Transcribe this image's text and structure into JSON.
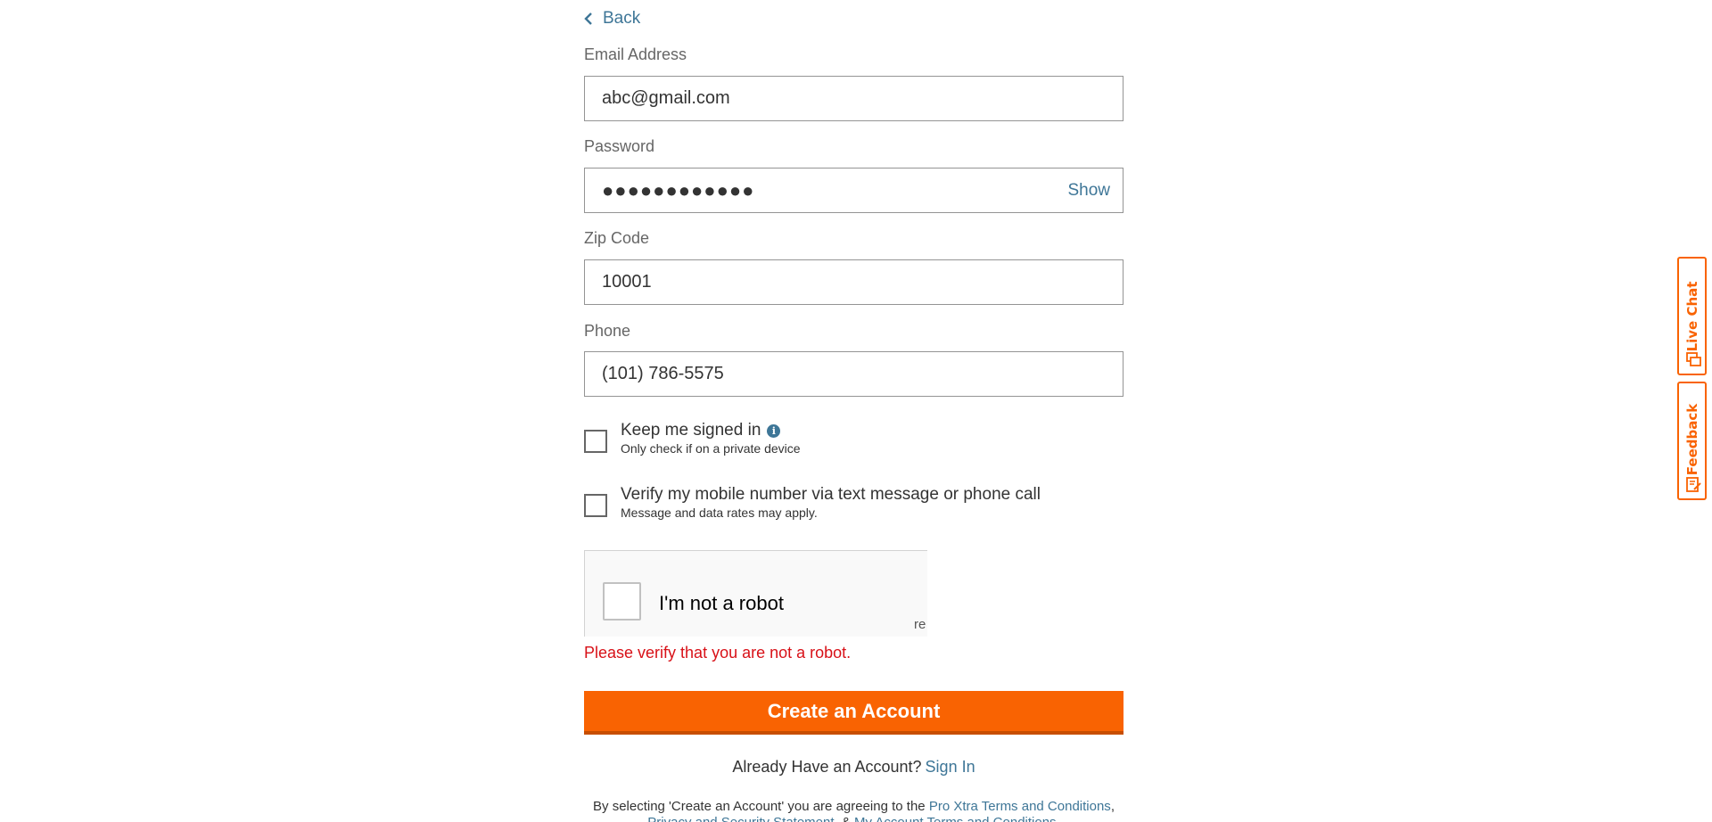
{
  "nav": {
    "back_label": "Back"
  },
  "form": {
    "email": {
      "label": "Email Address",
      "value": "abc@gmail.com"
    },
    "password": {
      "label": "Password",
      "masked_value": "●●●●●●●●●●●●",
      "show_label": "Show"
    },
    "zip": {
      "label": "Zip Code",
      "value": "10001"
    },
    "phone": {
      "label": "Phone",
      "value": "(101) 786-5575"
    },
    "keep_signed_in": {
      "label": "Keep me signed in",
      "sublabel": "Only check if on a private device",
      "checked": false,
      "info_icon": "info-icon"
    },
    "verify_mobile": {
      "label": "Verify my mobile number via text message or phone call",
      "sublabel": "Message and data rates may apply.",
      "checked": false
    }
  },
  "recaptcha": {
    "label": "I'm not a robot",
    "brand_fragment": "re"
  },
  "error_message": "Please verify that you are not a robot.",
  "submit_label": "Create an Account",
  "signin": {
    "prompt": "Already Have an Account?",
    "link": "Sign In"
  },
  "legal": {
    "prefix": "By selecting 'Create an Account' you are agreeing to the ",
    "link1": "Pro Xtra Terms and Conditions",
    "sep1": ",",
    "link2": "Privacy and Security Statement",
    "sep2": ", & ",
    "link3": "My Account Terms and Conditions",
    "suffix": "."
  },
  "side_tabs": {
    "live_chat": "Live Chat",
    "feedback": "Feedback"
  },
  "colors": {
    "accent": "#f96302",
    "link": "#3e7697",
    "error": "#d81118"
  }
}
